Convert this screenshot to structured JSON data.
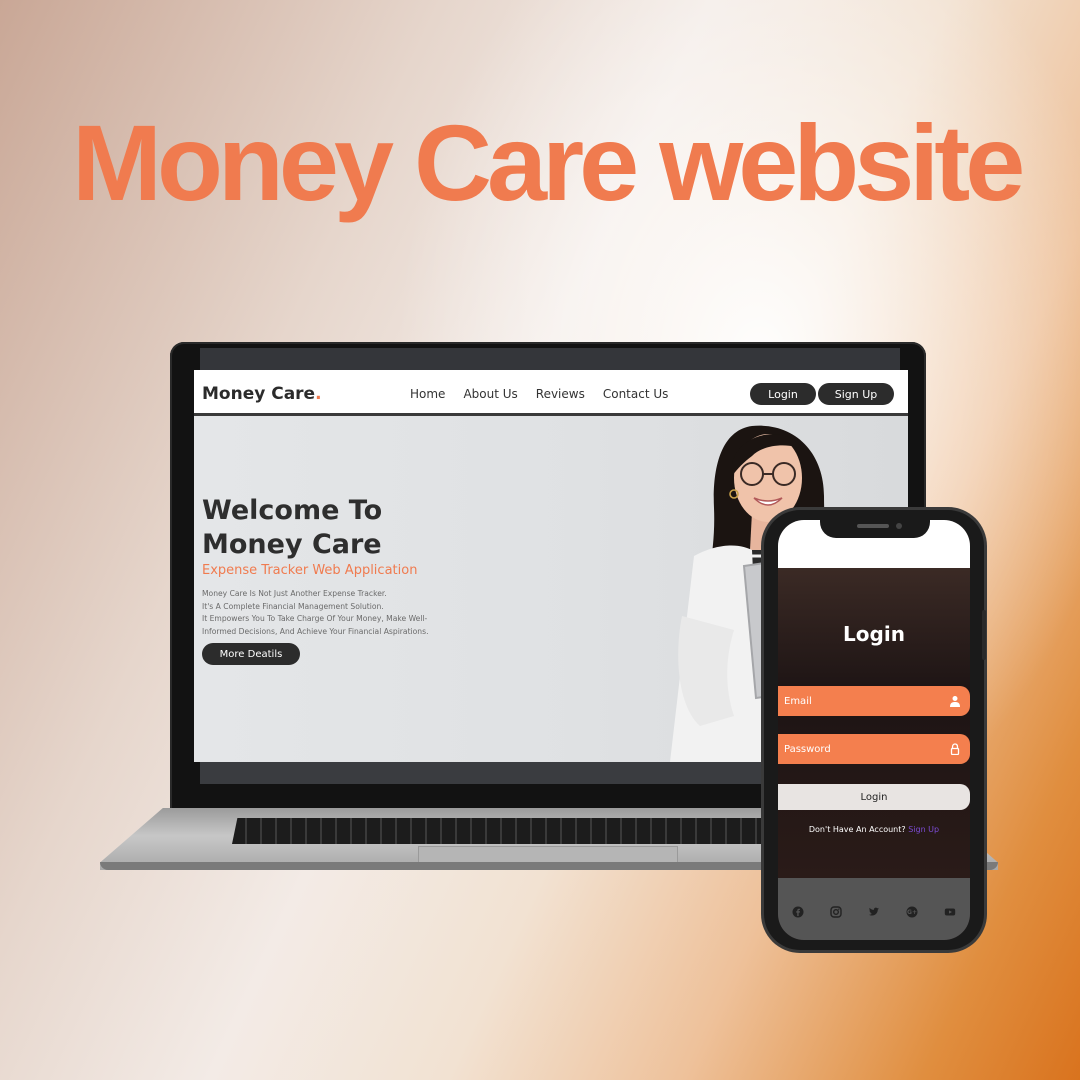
{
  "headline": "Money Care website",
  "laptop": {
    "logo": "Money Care",
    "logo_dot": ".",
    "nav_links": [
      "Home",
      "About Us",
      "Reviews",
      "Contact Us"
    ],
    "login_label": "Login",
    "signup_label": "Sign Up",
    "hero_title": "Welcome To Money Care",
    "hero_subtitle": "Expense Tracker Web Application",
    "hero_description": [
      "Money Care Is Not Just Another Expense Tracker.",
      "It's A Complete Financial Management Solution.",
      "It Empowers You To Take Charge Of Your Money, Make Well-",
      "Informed Decisions, And Achieve Your Financial Aspirations."
    ],
    "more_details_label": "More Deatils"
  },
  "phone": {
    "title": "Login",
    "email_placeholder": "Email",
    "password_placeholder": "Password",
    "login_button": "Login",
    "account_prompt": "Don't Have An Account?",
    "signup_link": "Sign Up",
    "social_icons": [
      "facebook-icon",
      "instagram-icon",
      "twitter-icon",
      "google-plus-icon",
      "youtube-icon"
    ]
  },
  "colors": {
    "accent": "#f07b4f",
    "dark_button": "#2c2c2c",
    "link_purple": "#7b4bd3"
  }
}
